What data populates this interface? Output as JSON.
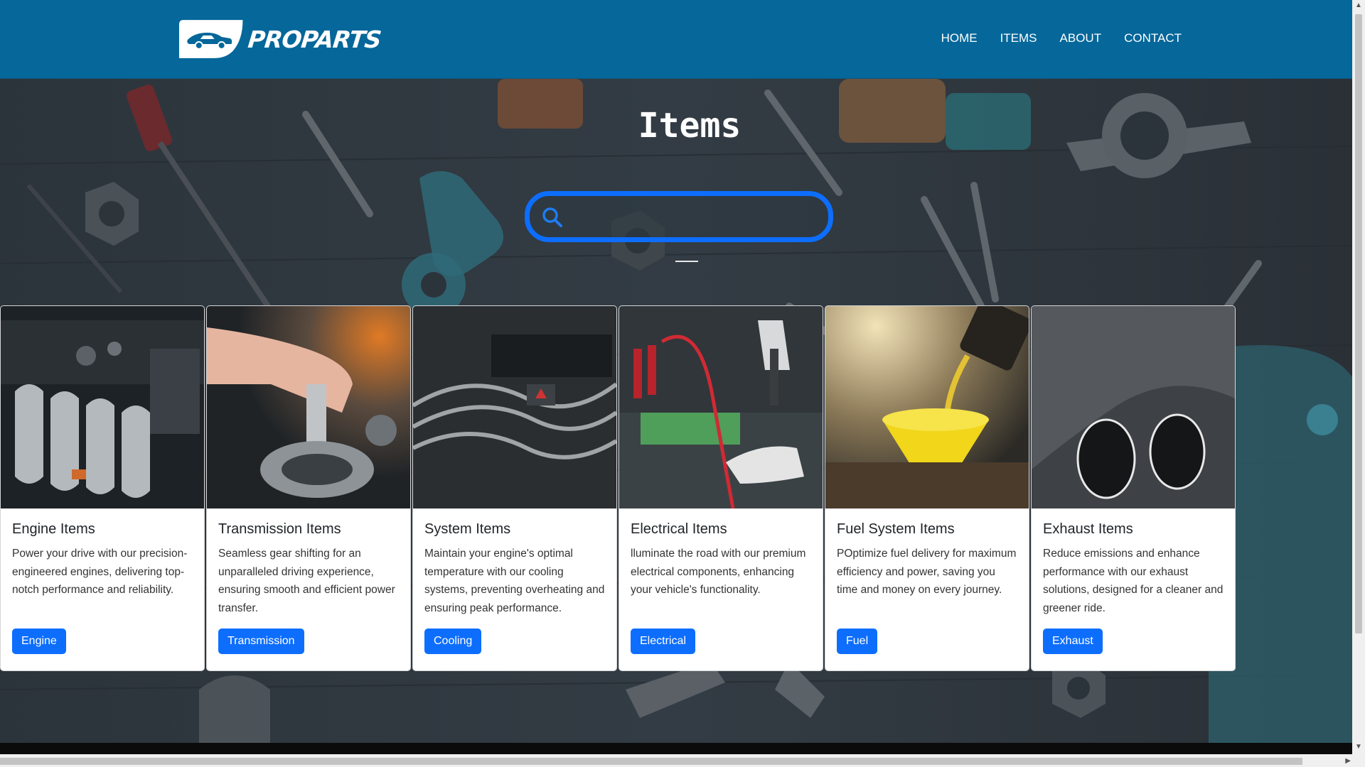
{
  "brand": {
    "name": "PROPARTS"
  },
  "nav": {
    "items": [
      {
        "label": "HOME"
      },
      {
        "label": "ITEMS"
      },
      {
        "label": "ABOUT"
      },
      {
        "label": "CONTACT"
      }
    ]
  },
  "hero": {
    "title": "Items"
  },
  "search": {
    "placeholder": "",
    "value": "",
    "icon": "search-icon"
  },
  "cards": [
    {
      "title": "Engine Items",
      "text": "Power your drive with our precision-engineered engines, delivering top-notch performance and reliability.",
      "button": "Engine"
    },
    {
      "title": "Transmission Items",
      "text": "Seamless gear shifting for an unparalleled driving experience, ensuring smooth and efficient power transfer.",
      "button": "Transmission"
    },
    {
      "title": "System Items",
      "text": "Maintain your engine's optimal temperature with our cooling systems, preventing overheating and ensuring peak performance.",
      "button": "Cooling"
    },
    {
      "title": "Electrical Items",
      "text": "lluminate the road with our premium electrical components, enhancing your vehicle's functionality.",
      "button": "Electrical"
    },
    {
      "title": "Fuel System Items",
      "text": "POptimize fuel delivery for maximum efficiency and power, saving you time and money on every journey.",
      "button": "Fuel"
    },
    {
      "title": "Exhaust Items",
      "text": "Reduce emissions and enhance performance with our exhaust solutions, designed for a cleaner and greener ride.",
      "button": "Exhaust"
    }
  ],
  "colors": {
    "header": "#05679a",
    "accent": "#0d6efd",
    "hero_overlay": "#2a333b"
  }
}
